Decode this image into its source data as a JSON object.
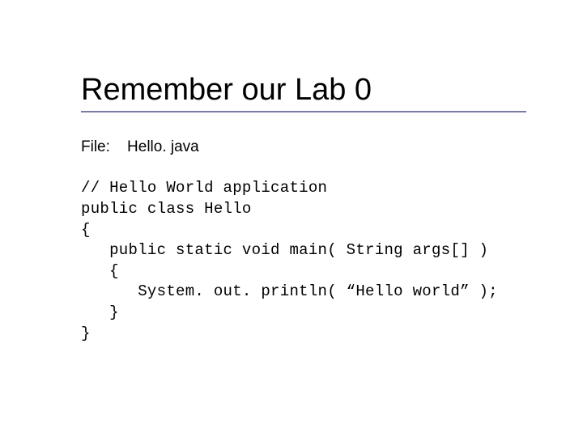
{
  "title": "Remember our Lab 0",
  "file_label": "File:",
  "filename": "Hello. java",
  "code_lines": {
    "l0": "// Hello World application",
    "l1": "public class Hello",
    "l2": "{",
    "l3": "   public static void main( String args[] )",
    "l4": "   {",
    "l5": "      System. out. println( “Hello world” );",
    "l6": "   }",
    "l7": "}"
  }
}
